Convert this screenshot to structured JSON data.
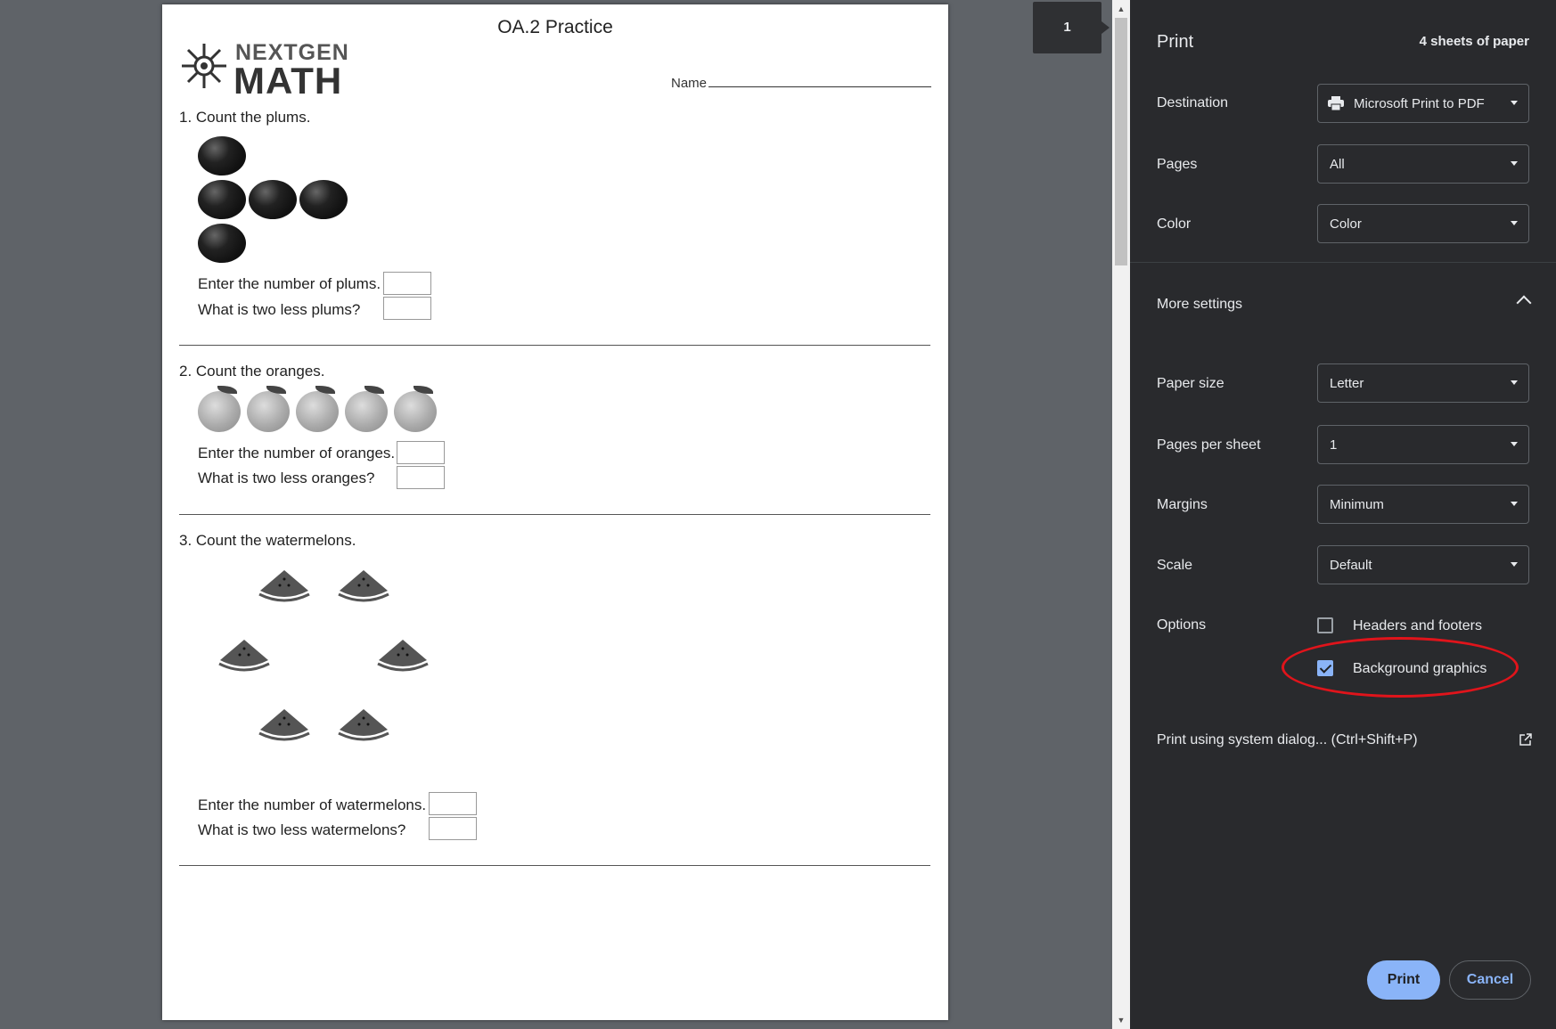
{
  "preview": {
    "page_badge": "1",
    "doc": {
      "title": "OA.2 Practice",
      "logo_top": "NEXTGEN",
      "logo_bottom": "MATH",
      "name_label": "Name",
      "q1": {
        "title": "1. Count the plums.",
        "line1": "Enter the number of plums.",
        "line2": "What is two less plums?"
      },
      "q2": {
        "title": "2. Count the oranges.",
        "line1": "Enter the number of oranges.",
        "line2": "What is two less oranges?"
      },
      "q3": {
        "title": "3. Count the watermelons.",
        "line1": "Enter the number of watermelons.",
        "line2": "What is two less watermelons?"
      }
    }
  },
  "sidebar": {
    "title": "Print",
    "sheets": "4 sheets of paper",
    "destination": {
      "label": "Destination",
      "value": "Microsoft Print to PDF"
    },
    "pages": {
      "label": "Pages",
      "value": "All"
    },
    "color": {
      "label": "Color",
      "value": "Color"
    },
    "more_settings": "More settings",
    "paper_size": {
      "label": "Paper size",
      "value": "Letter"
    },
    "pages_per_sheet": {
      "label": "Pages per sheet",
      "value": "1"
    },
    "margins": {
      "label": "Margins",
      "value": "Minimum"
    },
    "scale": {
      "label": "Scale",
      "value": "Default"
    },
    "options": {
      "label": "Options",
      "headers_footers": "Headers and footers",
      "background_graphics": "Background graphics"
    },
    "system_dialog": "Print using system dialog... (Ctrl+Shift+P)",
    "print_button": "Print",
    "cancel_button": "Cancel"
  },
  "colors": {
    "sidebar_bg": "#292a2d",
    "accent": "#8ab4f8",
    "highlight": "#e0141b",
    "preview_bg": "#5f6368"
  }
}
